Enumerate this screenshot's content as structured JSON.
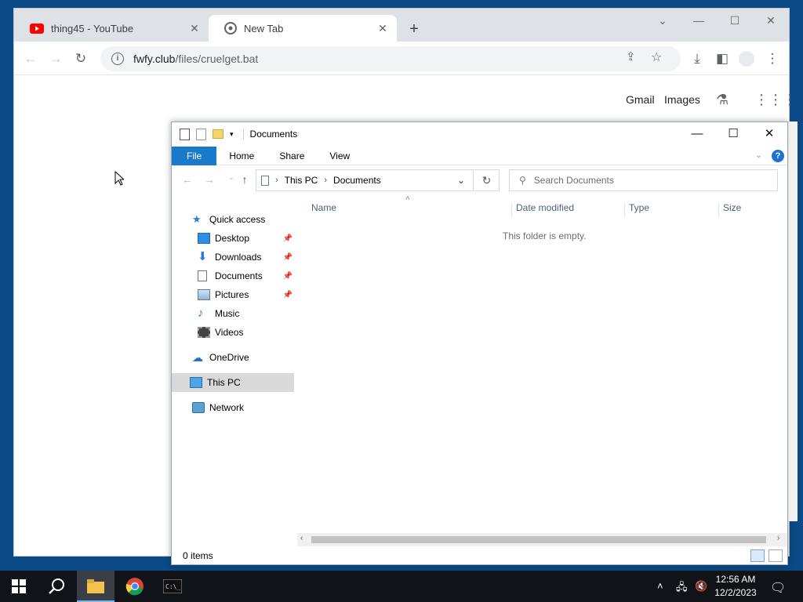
{
  "browser": {
    "tabs": [
      {
        "title": "thing45 - YouTube"
      },
      {
        "title": "New Tab"
      }
    ],
    "url_domain": "fwfy.club",
    "url_path": "/files/cruelget.bat",
    "links": {
      "gmail": "Gmail",
      "images": "Images"
    }
  },
  "explorer": {
    "title": "Documents",
    "ribbon_tabs": [
      "File",
      "Home",
      "Share",
      "View"
    ],
    "breadcrumb": [
      "This PC",
      "Documents"
    ],
    "search_placeholder": "Search Documents",
    "columns": [
      "Name",
      "Date modified",
      "Type",
      "Size"
    ],
    "empty_message": "This folder is empty.",
    "nav": {
      "quick_access": "Quick access",
      "items": [
        {
          "label": "Desktop",
          "pinned": true
        },
        {
          "label": "Downloads",
          "pinned": true
        },
        {
          "label": "Documents",
          "pinned": true
        },
        {
          "label": "Pictures",
          "pinned": true
        },
        {
          "label": "Music",
          "pinned": false
        },
        {
          "label": "Videos",
          "pinned": false
        }
      ],
      "onedrive": "OneDrive",
      "this_pc": "This PC",
      "network": "Network"
    },
    "status": "0 items"
  },
  "taskbar": {
    "time": "12:56 AM",
    "date": "12/2/2023"
  }
}
